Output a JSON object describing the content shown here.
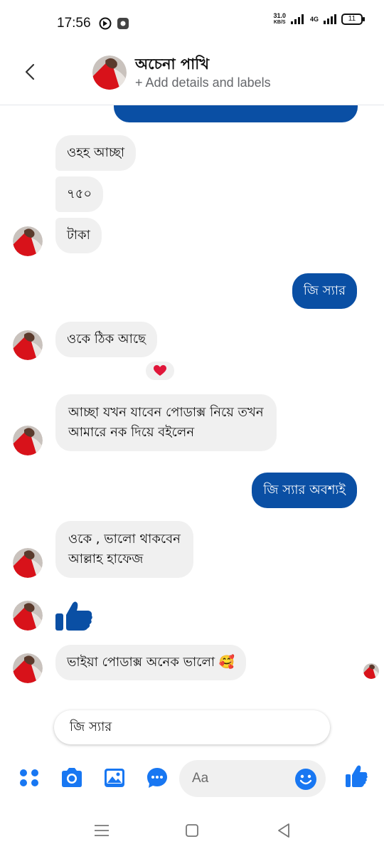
{
  "status_bar": {
    "time": "17:56",
    "net_speed_value": "31.0",
    "net_speed_unit": "KB/S",
    "network_type": "4G",
    "battery": "11"
  },
  "header": {
    "contact_name": "অচেনা পাখি",
    "subtitle": "+ Add details and labels"
  },
  "messages": [
    {
      "direction": "in",
      "text": "ওহহ আচ্ছা"
    },
    {
      "direction": "in",
      "text": "৭৫০"
    },
    {
      "direction": "in",
      "text": "টাকা"
    },
    {
      "direction": "out",
      "text": "জি স্যার"
    },
    {
      "direction": "in",
      "text": "ওকে ঠিক আছে",
      "reaction": "heart"
    },
    {
      "direction": "in",
      "lines": [
        "আচ্ছা যখন যাবেন পোডাক্স নিয়ে তখন",
        "আমারে নক দিয়ে বইলেন"
      ]
    },
    {
      "direction": "out",
      "text": "জি স্যার অবশ্যই"
    },
    {
      "direction": "in",
      "lines": [
        "ওকে , ভালো থাকবেন",
        "আল্লাহ হাফেজ"
      ]
    },
    {
      "direction": "in",
      "sticker": "thumbs-up"
    },
    {
      "direction": "in",
      "text": "ভাইয়া পোডাক্স অনেক ভালো",
      "emoji": "🥰"
    }
  ],
  "suggestion": {
    "text": "জি স্যার"
  },
  "composer": {
    "placeholder": "Aa"
  },
  "colors": {
    "accent": "#0a4fa4",
    "incoming_bubble": "#f0f0f0",
    "header_subtitle": "#65676b",
    "composer_icon": "#1877f2"
  },
  "icons": {
    "composer": [
      "apps-icon",
      "camera-icon",
      "gallery-icon",
      "chat-bubble-icon",
      "emoji-icon",
      "like-icon"
    ],
    "nav": [
      "menu-icon",
      "home-icon",
      "back-icon"
    ]
  }
}
